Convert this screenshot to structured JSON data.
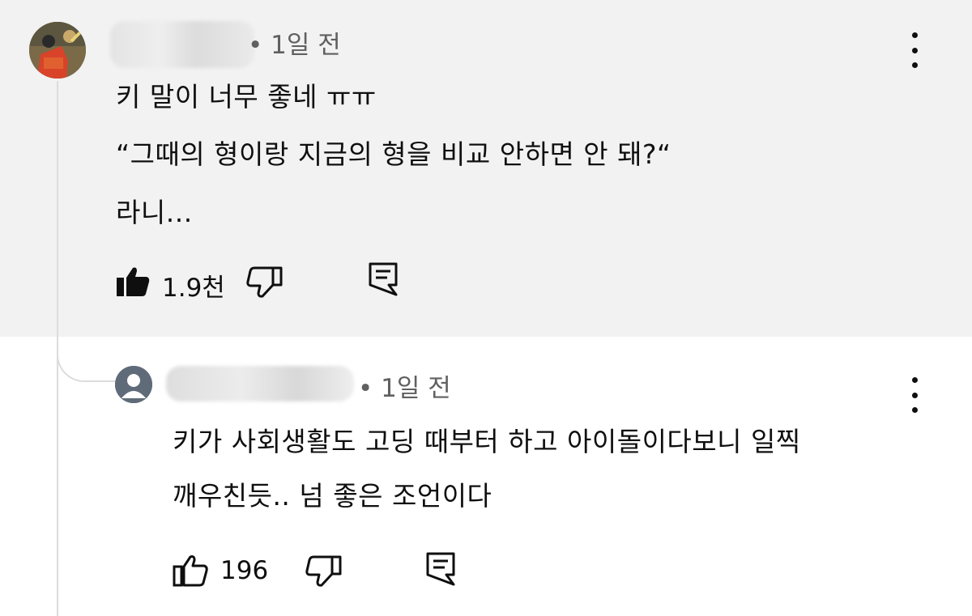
{
  "comment": {
    "time": "• 1일 전",
    "lines": [
      "키 말이 너무 좋네 ㅠㅠ",
      "“그때의 형이랑 지금의 형을 비교 안하면 안 돼?“",
      "라니..."
    ],
    "like_count": "1.9천",
    "liked": true
  },
  "reply": {
    "time": "• 1일 전",
    "lines": [
      "키가 사회생활도 고딩 때부터 하고 아이돌이다보니 일찍",
      "깨우친듯.. 넘 좋은 조언이다"
    ],
    "like_count": "196",
    "liked": false
  },
  "colors": {
    "highlight_bg": "#f2f2f2",
    "text": "#0f0f0f",
    "meta": "#606060"
  },
  "icons": [
    "thumbs-up-icon",
    "thumbs-down-icon",
    "reply-icon",
    "more-vert-icon",
    "avatar"
  ]
}
